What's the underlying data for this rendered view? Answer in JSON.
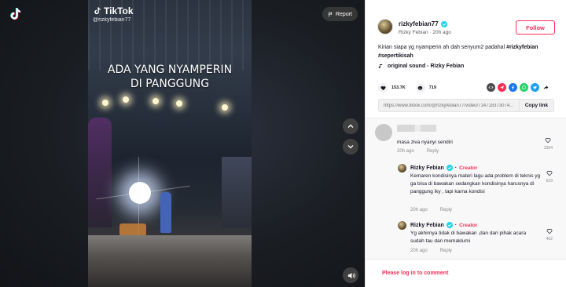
{
  "watermark": {
    "brand": "TikTok",
    "handle": "@rizkyfebian77"
  },
  "report_label": "Report",
  "video": {
    "caption_line1": "ADA YANG NYAMPERIN",
    "caption_line2": "DI PANGGUNG"
  },
  "author": {
    "username": "rizkyfebian77",
    "display_name": "Rizky Febian",
    "age": "20h ago",
    "follow_label": "Follow"
  },
  "post": {
    "description": "Kirian siapa yg nyamperin ah dah senyum2 padahal ",
    "hashtag1": "#rizkyfebian",
    "hashtag2": "#sepertikisah",
    "sound": "original sound - Rizky Febian",
    "likes": "153.7K",
    "comments": "719",
    "link": "https://www.tiktok.com/@rizkyfebian77/video/714718373074...",
    "copy_label": "Copy link"
  },
  "comments": [
    {
      "text": "masa ziva nyanyi sendiri",
      "time": "20h ago",
      "reply": "Reply",
      "likes": "3364"
    },
    {
      "name": "Rizky Febian",
      "badge": "Creator",
      "text": "Kemaren kondisinya materi lagu ada problem di teknis yg ga bisa di bawakan sedangkan kondisinya harusnya di panggung iky , tapi karna kondisi",
      "time": "20h ago",
      "reply": "Reply",
      "likes": "629"
    },
    {
      "name": "Rizky Febian",
      "badge": "Creator",
      "text": "Yg akhirnya tidak di bawakan ,dan dari pihak acara sudah tau dan memaklumi",
      "time": "20h ago",
      "reply": "Reply",
      "likes": "462"
    }
  ],
  "login_prompt": "Please log in to comment",
  "colors": {
    "accent": "#fe2c55",
    "verified": "#20d5ec",
    "dark": "#161823"
  }
}
